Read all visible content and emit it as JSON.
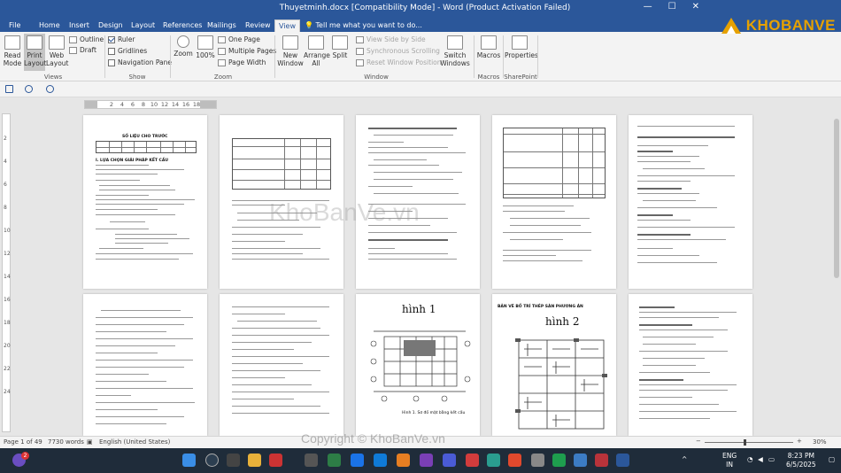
{
  "window": {
    "title": "Thuyetminh.docx [Compatibility Mode] - Word (Product Activation Failed)",
    "controls": [
      "—",
      "☐",
      "✕"
    ]
  },
  "tabs": {
    "file": "File",
    "items": [
      "Home",
      "Insert",
      "Design",
      "Layout",
      "References",
      "Mailings",
      "Review",
      "View"
    ],
    "active": "View",
    "tell_me": "Tell me what you want to do..."
  },
  "ribbon": {
    "views": {
      "read_mode": "Read Mode",
      "print_layout": "Print Layout",
      "web_layout": "Web Layout",
      "outline": "Outline",
      "draft": "Draft",
      "label": "Views"
    },
    "show": {
      "ruler": "Ruler",
      "gridlines": "Gridlines",
      "navigation_pane": "Navigation Pane",
      "label": "Show"
    },
    "zoom": {
      "zoom": "Zoom",
      "hundred": "100%",
      "one_page": "One Page",
      "multiple_pages": "Multiple Pages",
      "page_width": "Page Width",
      "label": "Zoom"
    },
    "window": {
      "new_window": "New Window",
      "arrange_all": "Arrange All",
      "split": "Split",
      "view_side_by_side": "View Side by Side",
      "synchronous_scrolling": "Synchronous Scrolling",
      "reset_window_position": "Reset Window Position",
      "switch_windows": "Switch Windows",
      "label": "Window"
    },
    "macros": {
      "macros": "Macros",
      "label": "Macros"
    },
    "sharepoint": {
      "properties": "Properties",
      "label": "SharePoint"
    }
  },
  "ruler": {
    "marks": [
      "2",
      "",
      "2",
      "4",
      "6",
      "8",
      "10",
      "12",
      "14",
      "16",
      "18"
    ]
  },
  "vruler": {
    "marks": [
      "2",
      "4",
      "6",
      "8",
      "10",
      "12",
      "14",
      "16",
      "18",
      "20",
      "22",
      "24"
    ]
  },
  "pages": {
    "p1_heading": "SỐ LIỆU CHO TRƯỚC",
    "p1_section": "I. LỰA CHỌN GIẢI PHÁP KẾT CẤU",
    "p9_title": "hình 1",
    "p9_caption": "Hình 1. Sơ đồ mặt bằng kết cấu",
    "p10_heading": "BẢN VẼ BỐ TRÍ THÉP SÀN PHƯƠNG ÁN",
    "p10_title": "hình 2"
  },
  "watermark": {
    "text": "KhoBanVe.vn",
    "copyright": "Copyright © KhoBanVe.vn"
  },
  "logo": {
    "text": "KHOBANVE"
  },
  "status": {
    "page": "Page 1 of 49",
    "words": "7730 words",
    "language": "English (United States)",
    "zoom": "30%"
  },
  "taskbar": {
    "lang_top": "ENG",
    "lang_bottom": "IN",
    "time": "8:23 PM",
    "date": "6/5/2025",
    "badge": "2"
  }
}
